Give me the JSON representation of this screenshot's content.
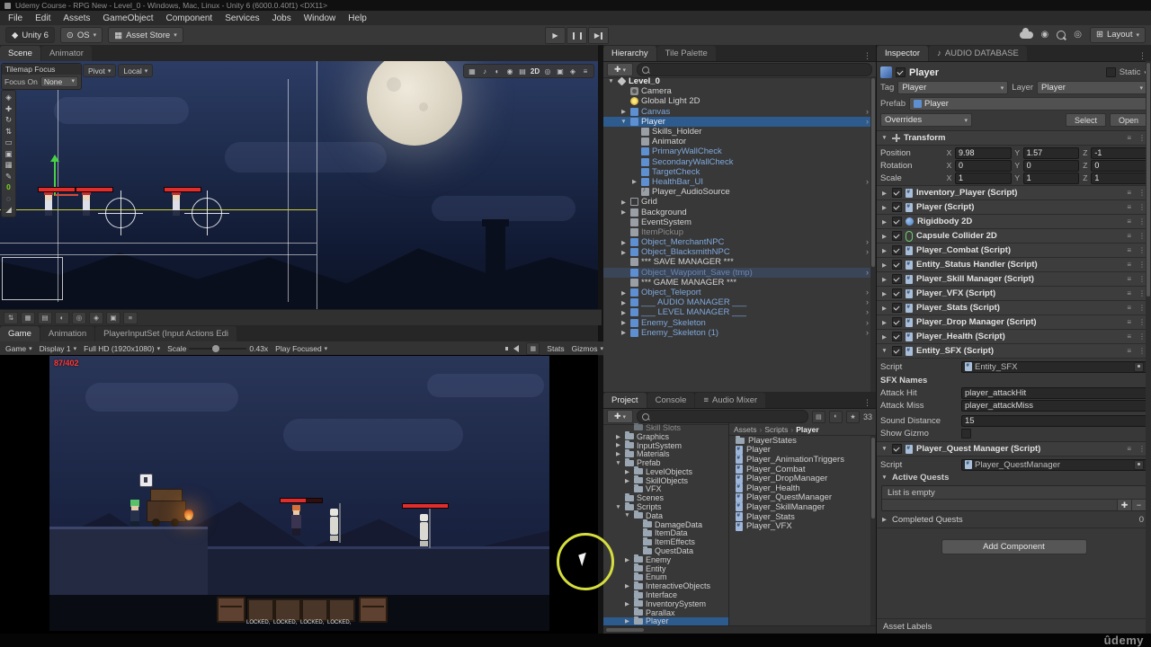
{
  "window": {
    "title": "Udemy Course - RPG New - Level_0 - Windows, Mac, Linux - Unity 6 (6000.0.40f1) <DX11>"
  },
  "menu": {
    "items": [
      "File",
      "Edit",
      "Assets",
      "GameObject",
      "Component",
      "Services",
      "Jobs",
      "Window",
      "Help"
    ]
  },
  "toolbar": {
    "unity_version": "Unity 6",
    "os_label": "OS",
    "asset_store_label": "Asset Store",
    "layout_label": "Layout",
    "icons": {
      "play": "▶",
      "layout_grid": "⊞",
      "os": "⊙",
      "store": "▦",
      "unity_logo": "◆"
    }
  },
  "scene": {
    "tab_scene": "Scene",
    "tab_animator": "Animator",
    "tilemap_focus": {
      "title": "Tilemap Focus",
      "focus_on_label": "Focus On",
      "value": "None"
    },
    "pivot_label": "Pivot",
    "handle_label": "Local",
    "left_tools": [
      "◈",
      "✚",
      "↻",
      "⇅",
      "▭",
      "▣",
      "▦",
      "✎",
      "0",
      "◌",
      "◢"
    ],
    "right_tools": [
      "▦",
      "♪",
      "◐",
      "◉",
      "▤",
      "2D",
      "◎",
      "▣",
      "◈",
      "≡"
    ],
    "bottom_tools": [
      "⇅",
      "▦",
      "▤",
      "◐",
      "◎",
      "◈",
      "▣",
      "≡"
    ]
  },
  "game": {
    "tab_game": "Game",
    "tab_animation": "Animation",
    "tab_input": "PlayerInputSet (Input Actions Edi",
    "toolbar": {
      "game_dd": "Game",
      "display": "Display 1",
      "resolution": "Full HD (1920x1080)",
      "scale_label": "Scale",
      "scale_value": "0.43x",
      "play_focused": "Play Focused",
      "stats_label": "Stats",
      "gizmos_label": "Gizmos"
    },
    "hud_health": "87/402",
    "locked_labels": [
      "LOCKED,",
      "LOCKED,",
      "LOCKED,",
      "LOCKED,"
    ]
  },
  "hierarchy": {
    "tab_hierarchy": "Hierarchy",
    "tab_tile_palette": "Tile Palette",
    "scene_name": "Level_0",
    "items": [
      {
        "label": "Camera",
        "indent": 1,
        "icon": "camera"
      },
      {
        "label": "Global Light 2D",
        "indent": 1,
        "icon": "light"
      },
      {
        "label": "Canvas",
        "indent": 1,
        "icon": "cube-blue",
        "prefab": true,
        "fold": "collapsed",
        "arrow": true
      },
      {
        "label": "Player",
        "indent": 1,
        "icon": "cube-blue",
        "prefab": true,
        "fold": "expanded",
        "selected": true,
        "arrow": true
      },
      {
        "label": "Skills_Holder",
        "indent": 2,
        "icon": "cube-gray"
      },
      {
        "label": "Animator",
        "indent": 2,
        "icon": "cube-gray"
      },
      {
        "label": "PrimaryWallCheck",
        "indent": 2,
        "icon": "cube-blue",
        "prefab": true
      },
      {
        "label": "SecondaryWallCheck",
        "indent": 2,
        "icon": "cube-blue",
        "prefab": true
      },
      {
        "label": "TargetCheck",
        "indent": 2,
        "icon": "cube-blue",
        "prefab": true
      },
      {
        "label": "HealthBar_UI",
        "indent": 2,
        "icon": "cube-blue",
        "prefab": true,
        "fold": "collapsed",
        "arrow": true
      },
      {
        "label": "Player_AudioSource",
        "indent": 2,
        "icon": "audio"
      },
      {
        "label": "Grid",
        "indent": 1,
        "icon": "grid",
        "fold": "collapsed"
      },
      {
        "label": "Background",
        "indent": 1,
        "icon": "cube-gray",
        "fold": "collapsed"
      },
      {
        "label": "EventSystem",
        "indent": 1,
        "icon": "cube-gray"
      },
      {
        "label": "ItemPickup",
        "indent": 1,
        "icon": "cube-gray",
        "disabled": true
      },
      {
        "label": "Object_MerchantNPC",
        "indent": 1,
        "icon": "cube-blue",
        "prefab": true,
        "fold": "collapsed",
        "arrow": true
      },
      {
        "label": "Object_BlacksmithNPC",
        "indent": 1,
        "icon": "cube-blue",
        "prefab": true,
        "fold": "collapsed",
        "arrow": true
      },
      {
        "label": "*** SAVE MANAGER ***",
        "indent": 1,
        "icon": "cube-gray"
      },
      {
        "label": "Object_Waypoint_Save (tmp)",
        "indent": 1,
        "icon": "cube-blue",
        "dimprefab": true,
        "dimsel": true,
        "arrow": true
      },
      {
        "label": "*** GAME MANAGER ***",
        "indent": 1,
        "icon": "cube-gray"
      },
      {
        "label": "Object_Teleport",
        "indent": 1,
        "icon": "cube-blue",
        "prefab": true,
        "fold": "collapsed",
        "arrow": true
      },
      {
        "label": "___ AUDIO MANAGER ___",
        "indent": 1,
        "icon": "cube-blue",
        "prefab": true,
        "fold": "collapsed",
        "arrow": true
      },
      {
        "label": "___ LEVEL MANAGER ___",
        "indent": 1,
        "icon": "cube-blue",
        "prefab": true,
        "fold": "collapsed",
        "arrow": true
      },
      {
        "label": "Enemy_Skeleton",
        "indent": 1,
        "icon": "cube-blue",
        "prefab": true,
        "fold": "collapsed",
        "arrow": true
      },
      {
        "label": "Enemy_Skeleton (1)",
        "indent": 1,
        "icon": "cube-blue",
        "prefab": true,
        "fold": "collapsed",
        "arrow": true
      }
    ]
  },
  "project": {
    "tab_project": "Project",
    "tab_console": "Console",
    "tab_mixer": "Audio Mixer",
    "hidden_count": "33",
    "tree": [
      {
        "label": "Skill Slots",
        "indent": 2,
        "dim": true
      },
      {
        "label": "Graphics",
        "indent": 1,
        "fold": "collapsed"
      },
      {
        "label": "InputSystem",
        "indent": 1,
        "fold": "collapsed"
      },
      {
        "label": "Materials",
        "indent": 1,
        "fold": "collapsed"
      },
      {
        "label": "Prefab",
        "indent": 1,
        "fold": "expanded"
      },
      {
        "label": "LevelObjects",
        "indent": 2,
        "fold": "collapsed"
      },
      {
        "label": "SkillObjects",
        "indent": 2,
        "fold": "collapsed"
      },
      {
        "label": "VFX",
        "indent": 2
      },
      {
        "label": "Scenes",
        "indent": 1
      },
      {
        "label": "Scripts",
        "indent": 1,
        "fold": "expanded"
      },
      {
        "label": "Data",
        "indent": 2,
        "fold": "expanded"
      },
      {
        "label": "DamageData",
        "indent": 3
      },
      {
        "label": "ItemData",
        "indent": 3
      },
      {
        "label": "ItemEffects",
        "indent": 3
      },
      {
        "label": "QuestData",
        "indent": 3
      },
      {
        "label": "Enemy",
        "indent": 2,
        "fold": "collapsed"
      },
      {
        "label": "Entity",
        "indent": 2
      },
      {
        "label": "Enum",
        "indent": 2
      },
      {
        "label": "InteractiveObjects",
        "indent": 2,
        "fold": "collapsed"
      },
      {
        "label": "Interface",
        "indent": 2
      },
      {
        "label": "InventorySystem",
        "indent": 2,
        "fold": "collapsed"
      },
      {
        "label": "Parallax",
        "indent": 2
      },
      {
        "label": "Player",
        "indent": 2,
        "fold": "collapsed",
        "selected": true
      }
    ],
    "breadcrumb": [
      "Assets",
      "Scripts",
      "Player"
    ],
    "files": [
      {
        "label": "PlayerStates",
        "type": "folder"
      },
      {
        "label": "Player",
        "type": "script"
      },
      {
        "label": "Player_AnimationTriggers",
        "type": "script"
      },
      {
        "label": "Player_Combat",
        "type": "script"
      },
      {
        "label": "Player_DropManager",
        "type": "script"
      },
      {
        "label": "Player_Health",
        "type": "script"
      },
      {
        "label": "Player_QuestManager",
        "type": "script"
      },
      {
        "label": "Player_SkillManager",
        "type": "script"
      },
      {
        "label": "Player_Stats",
        "type": "script"
      },
      {
        "label": "Player_VFX",
        "type": "script"
      }
    ]
  },
  "inspector": {
    "tab_inspector": "Inspector",
    "tab_audio": "AUDIO DATABASE",
    "header": {
      "name": "Player",
      "static_label": "Static",
      "tag_label": "Tag",
      "tag_value": "Player",
      "layer_label": "Layer",
      "layer_value": "Player",
      "prefab_label": "Prefab",
      "prefab_value": "Player",
      "overrides_label": "Overrides",
      "select_label": "Select",
      "open_label": "Open"
    },
    "transform": {
      "title": "Transform",
      "axis_x": "X",
      "axis_y": "Y",
      "axis_z": "Z",
      "rows": [
        {
          "label": "Position",
          "x": "9.98",
          "y": "1.57",
          "z": "-1"
        },
        {
          "label": "Rotation",
          "x": "0",
          "y": "0",
          "z": "0"
        },
        {
          "label": "Scale",
          "x": "1",
          "y": "1",
          "z": "1"
        }
      ]
    },
    "components": [
      {
        "name": "Inventory_Player (Script)",
        "icon": "script"
      },
      {
        "name": "Player (Script)",
        "icon": "script"
      },
      {
        "name": "Rigidbody 2D",
        "icon": "rigidbody"
      },
      {
        "name": "Capsule Collider 2D",
        "icon": "capsule"
      },
      {
        "name": "Player_Combat (Script)",
        "icon": "script"
      },
      {
        "name": "Entity_Status Handler (Script)",
        "icon": "script"
      },
      {
        "name": "Player_Skill Manager (Script)",
        "icon": "script"
      },
      {
        "name": "Player_VFX (Script)",
        "icon": "script"
      },
      {
        "name": "Player_Stats (Script)",
        "icon": "script"
      },
      {
        "name": "Player_Drop Manager (Script)",
        "icon": "script"
      },
      {
        "name": "Player_Health (Script)",
        "icon": "script"
      }
    ],
    "entity_sfx": {
      "name": "Entity_SFX (Script)",
      "script_label": "Script",
      "script_value": "Entity_SFX",
      "section": "SFX Names",
      "attack_hit_label": "Attack Hit",
      "attack_hit_value": "player_attackHit",
      "attack_miss_label": "Attack Miss",
      "attack_miss_value": "player_attackMiss",
      "sound_distance_label": "Sound Distance",
      "sound_distance_value": "15",
      "show_gizmo_label": "Show Gizmo"
    },
    "quest_manager": {
      "name": "Player_Quest Manager (Script)",
      "script_label": "Script",
      "script_value": "Player_QuestManager",
      "active_label": "Active Quests",
      "empty_text": "List is empty",
      "completed_label": "Completed Quests",
      "completed_count": "0"
    },
    "add_component_label": "Add Component",
    "asset_labels": "Asset Labels"
  },
  "brand": "ûdemy"
}
